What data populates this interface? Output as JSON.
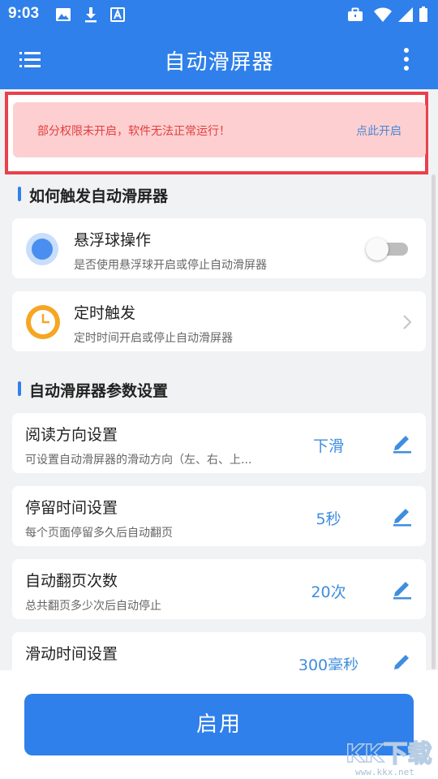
{
  "status_bar": {
    "time": "9:03",
    "left_icons": [
      "image-icon",
      "download-icon",
      "a-icon"
    ],
    "right_icons": [
      "briefcase-icon",
      "wifi-icon",
      "signal-icon",
      "battery-icon"
    ]
  },
  "app_bar": {
    "title": "自动滑屏器",
    "left_icon": "menu-icon",
    "right_icon": "more-vertical-icon"
  },
  "warning": {
    "text": "部分权限未开启，软件无法正常运行！",
    "link": "点此开启"
  },
  "sections": [
    {
      "title": "如何触发自动滑屏器",
      "items": [
        {
          "title": "悬浮球操作",
          "subtitle": "是否使用悬浮球开启或停止自动滑屏器",
          "icon": "floating-ball-icon",
          "control": "toggle",
          "toggle_on": false
        },
        {
          "title": "定时触发",
          "subtitle": "定时时间开启或停止自动滑屏器",
          "icon": "clock-icon",
          "control": "chevron-right-icon"
        }
      ]
    },
    {
      "title": "自动滑屏器参数设置",
      "items": [
        {
          "title": "阅读方向设置",
          "subtitle": "可设置自动滑屏器的滑动方向（左、右、上...",
          "value": "下滑",
          "icon": "edit-icon"
        },
        {
          "title": "停留时间设置",
          "subtitle": "每个页面停留多久后自动翻页",
          "value": "5秒",
          "icon": "edit-icon"
        },
        {
          "title": "自动翻页次数",
          "subtitle": "总共翻页多少次后自动停止",
          "value": "20次",
          "icon": "edit-icon"
        },
        {
          "title": "滑动时间设置",
          "subtitle": "",
          "value": "300毫秒",
          "icon": "edit-icon"
        }
      ]
    }
  ],
  "start_button": {
    "label": "启用"
  },
  "watermark": {
    "logo": "KK下载",
    "url": "www.kkx.net"
  },
  "colors": {
    "primary": "#2f80ea",
    "warning_bg": "#fdcfd0",
    "warning_text": "#e33d3d",
    "warning_outline": "#e9414c",
    "value_text": "#3f8ddf",
    "clock": "#f5a623"
  }
}
